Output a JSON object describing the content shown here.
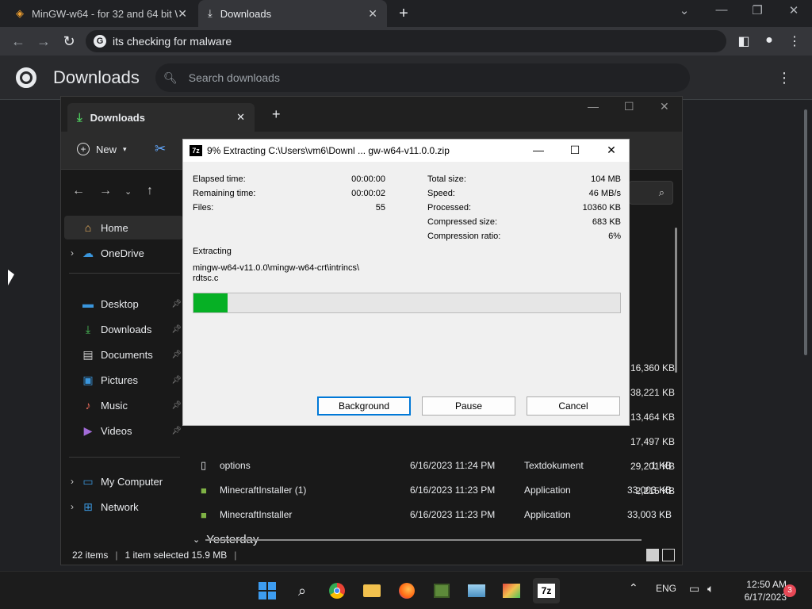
{
  "browser": {
    "tabs": [
      {
        "title": "MinGW-w64 - for 32 and 64 bit W"
      },
      {
        "title": "Downloads"
      }
    ],
    "omnibox_text": "its checking for malware"
  },
  "downloads_page": {
    "title": "Downloads",
    "search_placeholder": "Search downloads"
  },
  "explorer": {
    "tab_title": "Downloads",
    "new_label": "New",
    "nav_items": [
      {
        "label": "Home"
      },
      {
        "label": "OneDrive"
      },
      {
        "label": "Desktop"
      },
      {
        "label": "Downloads"
      },
      {
        "label": "Documents"
      },
      {
        "label": "Pictures"
      },
      {
        "label": "Music"
      },
      {
        "label": "Videos"
      },
      {
        "label": "My Computer"
      },
      {
        "label": "Network"
      }
    ],
    "top_sizes": [
      "16,360 KB",
      "38,221 KB",
      "13,464 KB",
      "17,497 KB",
      "29,201 KB",
      "2,215 KB"
    ],
    "group_label": "Yesterday",
    "files": [
      {
        "name": "options",
        "date": "6/16/2023 11:24 PM",
        "type": "Textdokument",
        "size": "1 KB"
      },
      {
        "name": "MinecraftInstaller (1)",
        "date": "6/16/2023 11:23 PM",
        "type": "Application",
        "size": "33,003 KB"
      },
      {
        "name": "MinecraftInstaller",
        "date": "6/16/2023 11:23 PM",
        "type": "Application",
        "size": "33,003 KB"
      }
    ],
    "status": {
      "items": "22 items",
      "selected": "1 item selected  15.9 MB"
    }
  },
  "zip_dialog": {
    "title": "9% Extracting C:\\Users\\vm6\\Downl ... gw-w64-v11.0.0.zip",
    "left_stats": [
      {
        "label": "Elapsed time:",
        "value": "00:00:00"
      },
      {
        "label": "Remaining time:",
        "value": "00:00:02"
      },
      {
        "label": "Files:",
        "value": "55"
      }
    ],
    "right_stats": [
      {
        "label": "Total size:",
        "value": "104 MB"
      },
      {
        "label": "Speed:",
        "value": "46 MB/s"
      },
      {
        "label": "Processed:",
        "value": "10360 KB"
      },
      {
        "label": "Compressed size:",
        "value": "683 KB"
      },
      {
        "label": "Compression ratio:",
        "value": "6%"
      }
    ],
    "status_label": "Extracting",
    "current_path_line1": "mingw-w64-v11.0.0\\mingw-w64-crt\\intrincs\\",
    "current_path_line2": "rdtsc.c",
    "progress_fraction": 0.08,
    "buttons": {
      "background": "Background",
      "pause": "Pause",
      "cancel": "Cancel"
    }
  },
  "taskbar": {
    "language": "ENG",
    "time": "12:50 AM",
    "date": "6/17/2023",
    "notifications": "3"
  },
  "colors": {
    "progress_green": "#06b025",
    "accent_blue": "#0078d7"
  }
}
